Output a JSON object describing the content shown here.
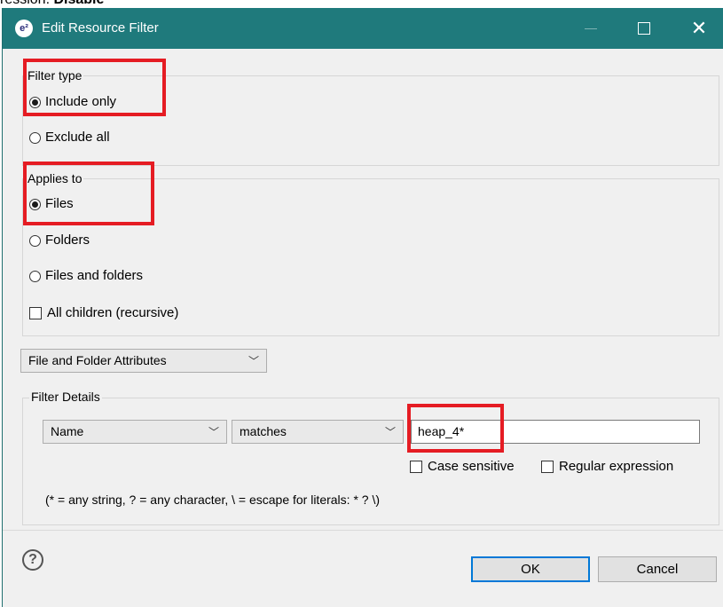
{
  "caption": {
    "prefix": "ression: ",
    "bold": "Disable"
  },
  "window": {
    "title": "Edit Resource Filter",
    "icon_text": "e²",
    "close_glyph": "✕"
  },
  "filter_type": {
    "legend": "Filter type",
    "options": [
      {
        "label": "Include only",
        "checked": true
      },
      {
        "label": "Exclude all",
        "checked": false
      }
    ]
  },
  "applies_to": {
    "legend": "Applies to",
    "options": [
      {
        "label": "Files",
        "checked": true
      },
      {
        "label": "Folders",
        "checked": false
      },
      {
        "label": "Files and folders",
        "checked": false
      }
    ],
    "recursive": {
      "label": "All children (recursive)",
      "checked": false
    }
  },
  "attribute_select": {
    "value": "File and Folder Attributes"
  },
  "filter_details": {
    "legend": "Filter details",
    "legend_display": "Filter Details",
    "attribute": "Name",
    "operator": "matches",
    "pattern": "heap_4*",
    "case_sensitive": {
      "label": "Case sensitive",
      "checked": false
    },
    "regex": {
      "label": "Regular expression",
      "checked": false
    },
    "hint": "(* = any string, ? = any character, \\ = escape for literals: * ? \\)"
  },
  "footer": {
    "help": "?",
    "ok": "OK",
    "cancel": "Cancel"
  },
  "colors": {
    "titlebar": "#1f7a7c",
    "highlight": "#e51c23",
    "dialog_bg": "#f0f0f0"
  }
}
